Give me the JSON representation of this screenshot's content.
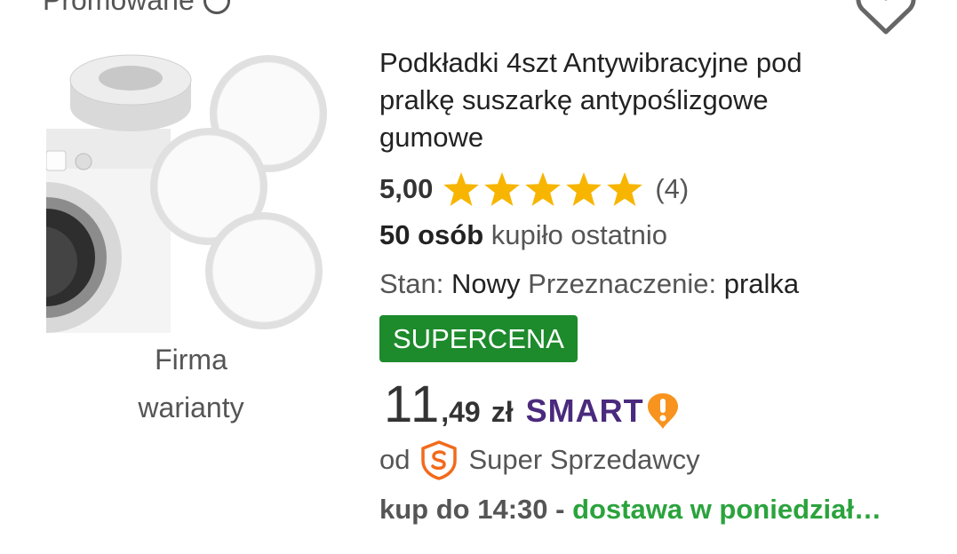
{
  "top": {
    "cut_label": "Promowane"
  },
  "product": {
    "title": "Podkładki 4szt Antywibracyjne pod pralkę suszarkę antypoślizgowe gumowe",
    "variants_line1": "Firma",
    "variants_line2": "warianty",
    "image_icon": "product-photo"
  },
  "rating": {
    "value": "5,00",
    "stars": 5,
    "count": "(4)",
    "star_color": "#f7b500"
  },
  "bought": {
    "bold": "50 osób",
    "rest": "kupiło ostatnio"
  },
  "params": {
    "stan_label": "Stan:",
    "stan_value": "Nowy",
    "dest_label": "Przeznaczenie:",
    "dest_value": "pralka"
  },
  "badge": {
    "label": "SUPERCENA",
    "color": "#1d8a2c"
  },
  "price": {
    "integer": "11",
    "decimal": ",49",
    "currency": "zł",
    "smart_label": "SMART"
  },
  "seller": {
    "prefix": "od",
    "name": "Super Sprzedawcy",
    "icon": "super-seller-icon",
    "icon_color": "#f26a1b"
  },
  "delivery": {
    "prefix": "kup do 14:30 -",
    "highlight": "dostawa w poniedział…",
    "highlight_color": "#2ba33d"
  }
}
